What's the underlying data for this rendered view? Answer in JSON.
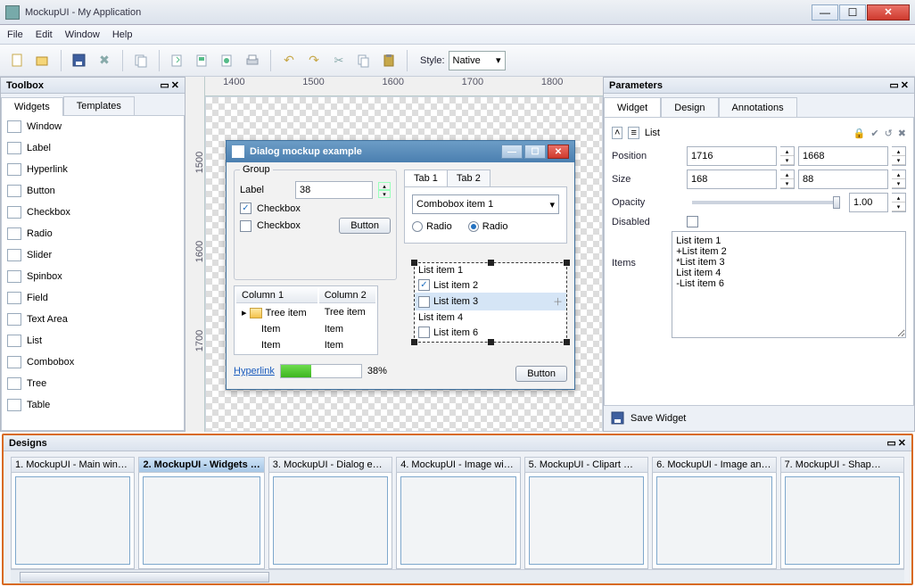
{
  "window": {
    "title": "MockupUI - My Application"
  },
  "menu": [
    "File",
    "Edit",
    "Window",
    "Help"
  ],
  "toolbar": {
    "style_label": "Style:",
    "style_value": "Native"
  },
  "toolbox": {
    "title": "Toolbox",
    "tabs": [
      "Widgets",
      "Templates"
    ],
    "items": [
      "Window",
      "Label",
      "Hyperlink",
      "Button",
      "Checkbox",
      "Radio",
      "Slider",
      "Spinbox",
      "Field",
      "Text Area",
      "List",
      "Combobox",
      "Tree",
      "Table"
    ]
  },
  "ruler_h": [
    "1400",
    "1500",
    "1600",
    "1700",
    "1800"
  ],
  "ruler_v": [
    "1500",
    "1600",
    "1700"
  ],
  "dialog": {
    "title": "Dialog mockup example",
    "group_label": "Group",
    "label_text": "Label",
    "label_value": "38",
    "checkbox1": "Checkbox",
    "checkbox2": "Checkbox",
    "button": "Button",
    "tabs": [
      "Tab 1",
      "Tab 2"
    ],
    "combo": "Combobox item 1",
    "radio1": "Radio",
    "radio2": "Radio",
    "columns": [
      "Column 1",
      "Column 2"
    ],
    "tree": [
      [
        "Tree item",
        "Tree item"
      ],
      [
        "Item",
        "Item"
      ],
      [
        "Item",
        "Item"
      ]
    ],
    "hyperlink": "Hyperlink",
    "progress_pct": "38%",
    "button2": "Button",
    "listsel": [
      "List item 1",
      "List item 2",
      "List item 3",
      "List item 4",
      "List item 6"
    ]
  },
  "parameters": {
    "title": "Parameters",
    "tabs": [
      "Widget",
      "Design",
      "Annotations"
    ],
    "widget_type": "List",
    "position_label": "Position",
    "position_x": "1716",
    "position_y": "1668",
    "size_label": "Size",
    "size_w": "168",
    "size_h": "88",
    "opacity_label": "Opacity",
    "opacity_val": "1.00",
    "disabled_label": "Disabled",
    "items_label": "Items",
    "items_text": "List item 1\n+List item 2\n*List item 3\nList item 4\n-List item 6",
    "save_label": "Save Widget"
  },
  "designs": {
    "title": "Designs",
    "thumbs": [
      "1. MockupUI - Main win…",
      "2. MockupUI - Widgets …",
      "3. MockupUI - Dialog e…",
      "4. MockupUI - Image wi…",
      "5. MockupUI - Clipart …",
      "6. MockupUI - Image an…",
      "7. MockupUI - Shap…"
    ],
    "active": 1
  }
}
